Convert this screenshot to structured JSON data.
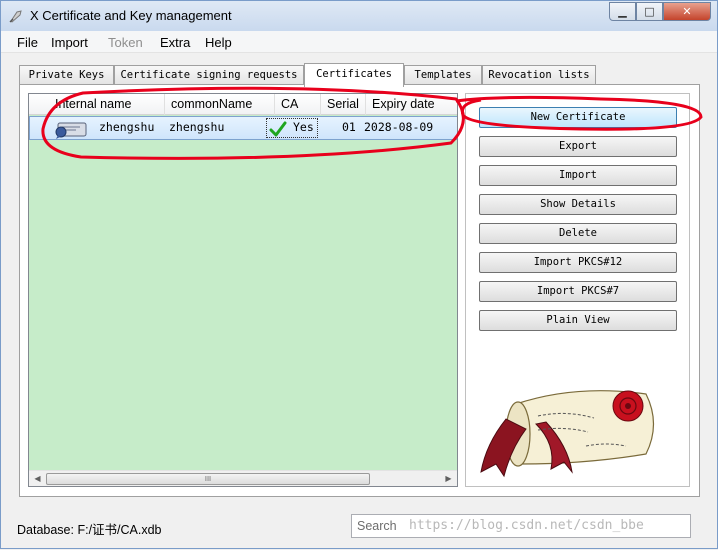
{
  "window": {
    "title": "X Certificate and Key management",
    "minimize_glyph": "▁",
    "maximize_glyph": "□",
    "close_glyph": "✕"
  },
  "menu": [
    "File",
    "Import",
    "Token",
    "Extra",
    "Help"
  ],
  "tabs": [
    "Private Keys",
    "Certificate signing requests",
    "Certificates",
    "Templates",
    "Revocation lists"
  ],
  "active_tab": "Certificates",
  "table": {
    "columns": [
      "Internal name",
      "commonName",
      "CA",
      "Serial",
      "Expiry date"
    ],
    "rows": [
      {
        "internal_name": "zhengshu",
        "common_name": "zhengshu",
        "ca": "Yes",
        "serial": "01",
        "expiry": "2028-08-09"
      }
    ]
  },
  "scrollbar": {
    "thumb_glyph": "III",
    "left_glyph": "◀",
    "right_glyph": "▶"
  },
  "buttons": [
    "New Certificate",
    "Export",
    "Import",
    "Show Details",
    "Delete",
    "Import PKCS#12",
    "Import PKCS#7",
    "Plain View"
  ],
  "status": {
    "database": "Database: F:/证书/CA.xdb"
  },
  "search": {
    "placeholder": "Search"
  },
  "watermark": "https://blog.csdn.net/csdn_bbe",
  "icons": [
    "app-icon",
    "certificate-icon",
    "checkmark-icon",
    "scroll-logo"
  ],
  "colors": {
    "list_background": "#c6ecc9",
    "annotation": "#e8001c",
    "check": "#1fa51f"
  }
}
